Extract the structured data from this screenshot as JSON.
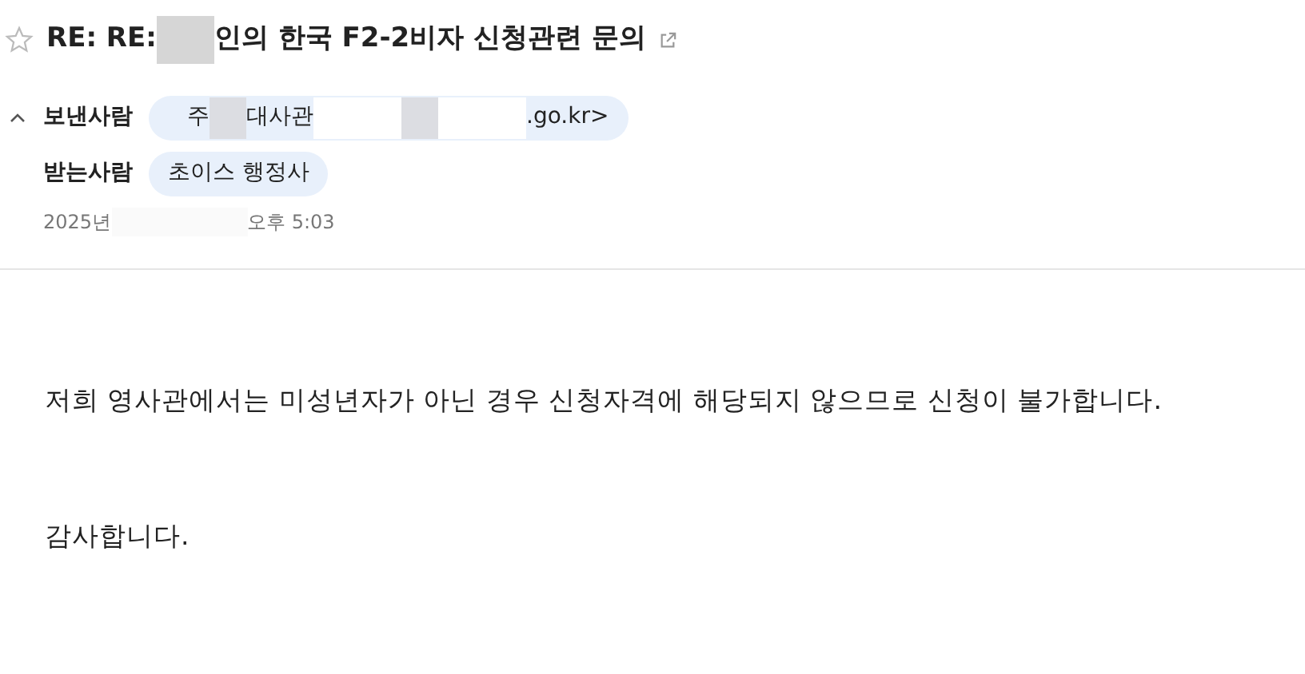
{
  "subject": {
    "starred": false,
    "parts": [
      {
        "kind": "text",
        "text": "RE: RE:"
      },
      {
        "kind": "redaction"
      },
      {
        "kind": "text",
        "text": "인의 한국 F2-2비자 신청관련 문의"
      }
    ]
  },
  "sender": {
    "label": "보낸사람",
    "expanded": true,
    "parts": [
      {
        "kind": "text",
        "text": "주"
      },
      {
        "kind": "redaction"
      },
      {
        "kind": "text",
        "text": "대사관"
      },
      {
        "kind": "blank"
      },
      {
        "kind": "redaction"
      },
      {
        "kind": "blank"
      },
      {
        "kind": "text",
        "text": ".go.kr>"
      }
    ]
  },
  "recipient": {
    "label": "받는사람",
    "parts": [
      {
        "kind": "text",
        "text": "초이스 행정사"
      }
    ]
  },
  "date": {
    "parts": [
      {
        "kind": "text",
        "text": "2025년"
      },
      {
        "kind": "blank"
      },
      {
        "kind": "text",
        "text": "오후 5:03"
      }
    ]
  },
  "body": [
    "저희 영사관에서는 미성년자가 아닌 경우 신청자격에 해당되지 않으므로 신청이 불가합니다.",
    "감사합니다."
  ]
}
